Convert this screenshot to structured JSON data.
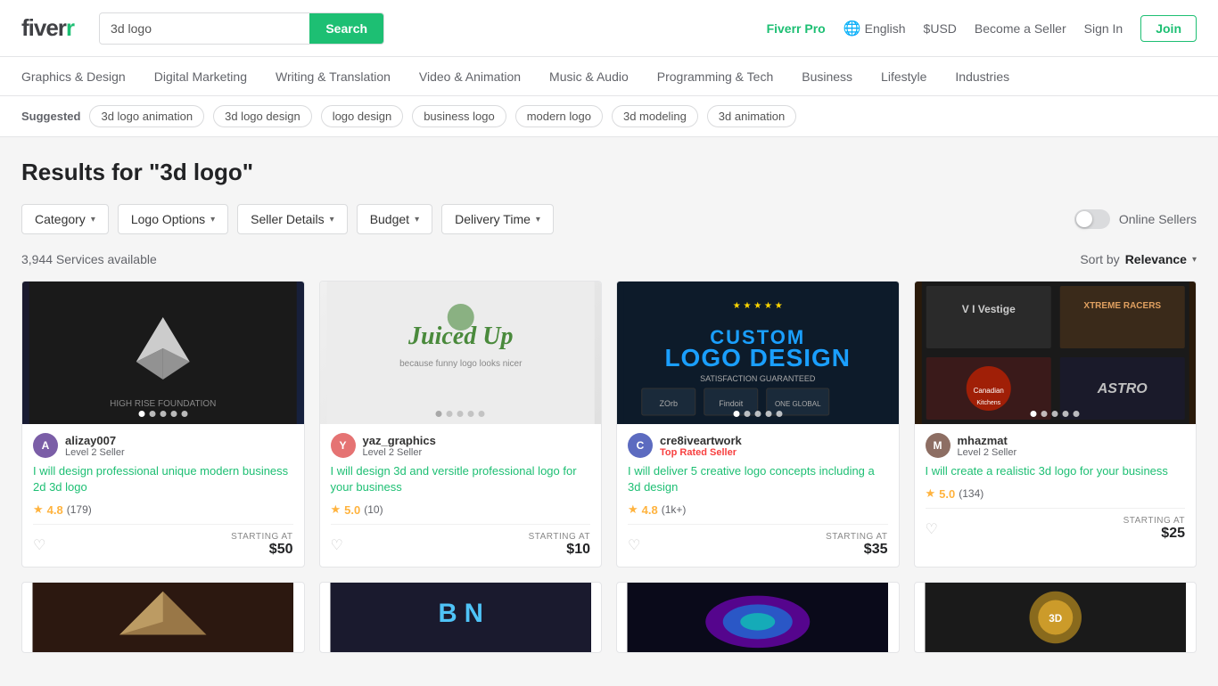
{
  "header": {
    "logo_text": "fiverr",
    "search_placeholder": "3d logo",
    "search_button": "Search",
    "fiverr_pro": "Fiverr Pro",
    "language": "English",
    "currency": "$USD",
    "become_seller": "Become a Seller",
    "sign_in": "Sign In",
    "join": "Join"
  },
  "nav": {
    "items": [
      "Graphics & Design",
      "Digital Marketing",
      "Writing & Translation",
      "Video & Animation",
      "Music & Audio",
      "Programming & Tech",
      "Business",
      "Lifestyle",
      "Industries"
    ]
  },
  "suggested": {
    "label": "Suggested",
    "tags": [
      "3d logo animation",
      "3d logo design",
      "logo design",
      "business logo",
      "modern logo",
      "3d modeling",
      "3d animation"
    ]
  },
  "results": {
    "title": "Results for \"3d logo\"",
    "count": "3,944 Services available",
    "sort_prefix": "Sort by",
    "sort_value": "Relevance"
  },
  "filters": [
    {
      "label": "Category"
    },
    {
      "label": "Logo Options"
    },
    {
      "label": "Seller Details"
    },
    {
      "label": "Budget"
    },
    {
      "label": "Delivery Time"
    }
  ],
  "online_sellers_label": "Online Sellers",
  "cards": [
    {
      "id": 1,
      "seller_name": "alizay007",
      "seller_level": "Level 2 Seller",
      "is_top": false,
      "avatar_bg": "#7b5ea7",
      "avatar_letter": "A",
      "title": "I will design professional unique modern business 2d 3d logo",
      "rating": "4.8",
      "review_count": "(179)",
      "starting_at": "STARTING AT",
      "price": "$50",
      "dots": 5,
      "bg": "dark"
    },
    {
      "id": 2,
      "seller_name": "yaz_graphics",
      "seller_level": "Level 2 Seller",
      "is_top": false,
      "avatar_bg": "#e57373",
      "avatar_letter": "Y",
      "title": "I will design 3d and versitle professional logo for your business",
      "rating": "5.0",
      "review_count": "(10)",
      "starting_at": "STARTING AT",
      "price": "$10",
      "dots": 5,
      "bg": "gray"
    },
    {
      "id": 3,
      "seller_name": "cre8iveartwork",
      "seller_level": "Top Rated Seller",
      "is_top": true,
      "avatar_bg": "#5c6bc0",
      "avatar_letter": "C",
      "title": "I will deliver 5 creative logo concepts including a 3d design",
      "rating": "4.8",
      "review_count": "(1k+)",
      "starting_at": "STARTING AT",
      "price": "$35",
      "dots": 5,
      "bg": "blue-dark"
    },
    {
      "id": 4,
      "seller_name": "mhazmat",
      "seller_level": "Level 2 Seller",
      "is_top": false,
      "avatar_bg": "#8d6e63",
      "avatar_letter": "M",
      "title": "I will create a realistic 3d logo for your business",
      "rating": "5.0",
      "review_count": "(134)",
      "starting_at": "STARTING AT",
      "price": "$25",
      "dots": 5,
      "bg": "brown"
    }
  ],
  "partial_cards": [
    {
      "id": 5,
      "bg": "partial1"
    },
    {
      "id": 6,
      "bg": "partial2"
    },
    {
      "id": 7,
      "bg": "partial3"
    },
    {
      "id": 8,
      "bg": "partial4"
    }
  ]
}
